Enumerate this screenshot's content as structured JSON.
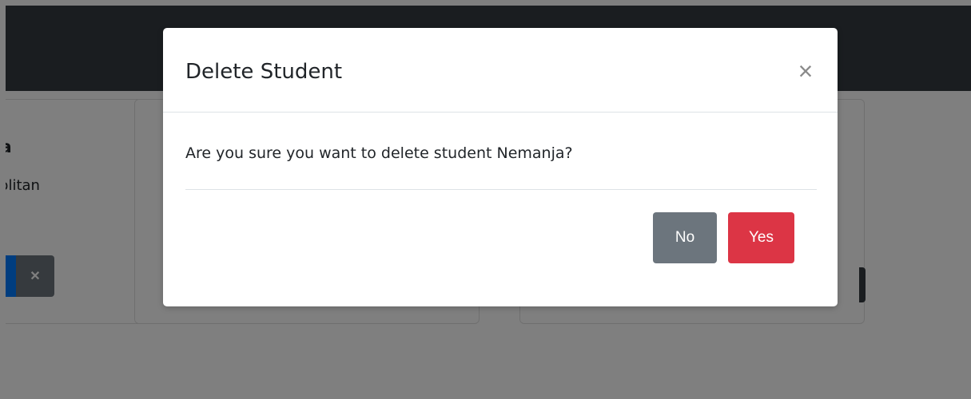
{
  "background_cards": [
    {
      "title": "sa",
      "text": "politan"
    }
  ],
  "modal": {
    "title": "Delete Student",
    "close_symbol": "×",
    "message": "Are you sure you want to delete student Nemanja?",
    "buttons": {
      "no_label": "No",
      "yes_label": "Yes"
    }
  },
  "icons": {
    "edit": "pencil-icon",
    "delete": "x-icon",
    "close": "close-icon"
  },
  "colors": {
    "navbar": "#343a40",
    "backdrop": "rgba(0,0,0,0.5)",
    "primary": "#007bff",
    "secondary": "#6c757d",
    "danger": "#dc3545"
  }
}
